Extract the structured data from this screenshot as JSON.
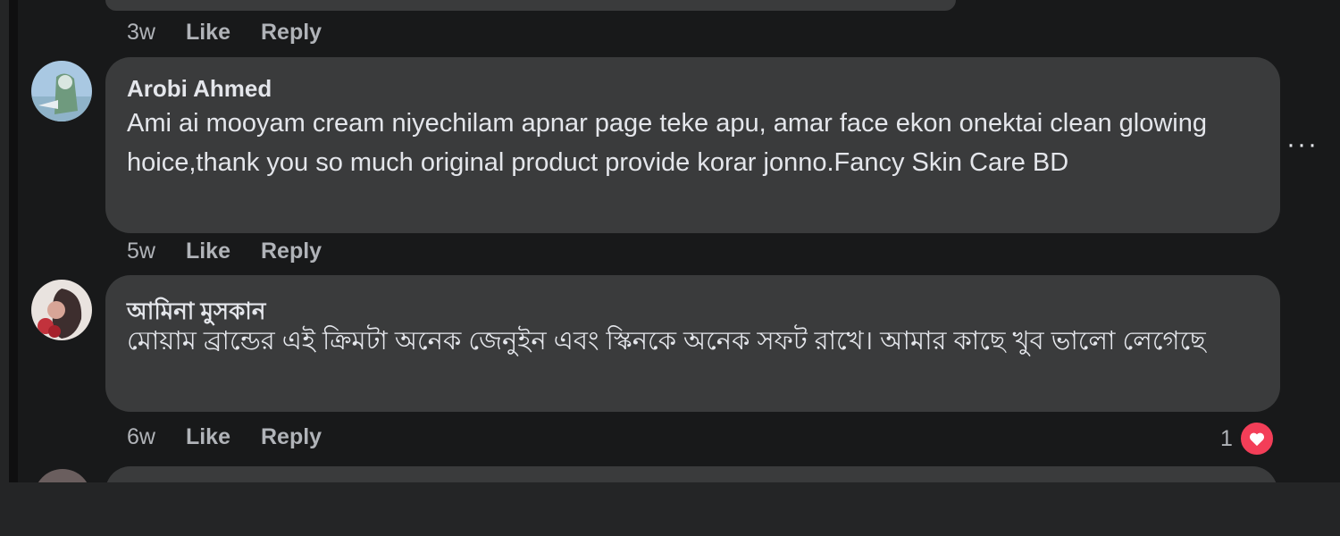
{
  "top_actions": {
    "time": "3w",
    "like": "Like",
    "reply": "Reply"
  },
  "comments": [
    {
      "author": "Arobi Ahmed",
      "text": "Ami ai mooyam cream niyechilam apnar page teke apu, amar face ekon onektai clean glowing hoice,thank you so much original product provide korar jonno.Fancy Skin Care BD",
      "time": "5w",
      "like": "Like",
      "reply": "Reply"
    },
    {
      "author": "আমিনা মুসকান",
      "text": "মোয়াম ব্রান্ডের এই ক্রিমটা অনেক জেনুইন এবং স্কিনকে অনেক সফট রাখে। আমার কাছে খুব ভালো লেগেছে",
      "time": "6w",
      "like": "Like",
      "reply": "Reply",
      "reaction_count": "1",
      "reaction_icon": "heart-icon",
      "reaction_color": "#f33e58"
    }
  ],
  "more_icon": "ellipsis-icon",
  "colors": {
    "bubble": "#3a3b3c",
    "background": "#18191a",
    "primary_text": "#e4e6eb",
    "secondary_text": "#b0b3b8"
  }
}
